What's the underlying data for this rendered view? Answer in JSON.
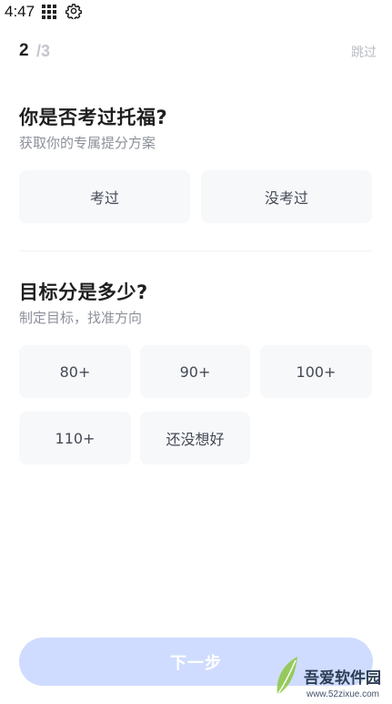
{
  "status_bar": {
    "time": "4:47",
    "icons": [
      "grid-icon",
      "gear-icon"
    ]
  },
  "progress": {
    "current": "2",
    "total": "/3",
    "skip_label": "跳过"
  },
  "question1": {
    "title": "你是否考过托福?",
    "subtitle": "获取你的专属提分方案",
    "options": [
      "考过",
      "没考过"
    ]
  },
  "question2": {
    "title": "目标分是多少?",
    "subtitle": "制定目标，找准方向",
    "options": [
      "80+",
      "90+",
      "100+",
      "110+",
      "还没想好"
    ]
  },
  "footer": {
    "next_label": "下一步"
  },
  "watermark": {
    "brand": "吾爱软件园",
    "url": "www.52zixue.com"
  },
  "colors": {
    "accent_disabled": "#cfdcff",
    "option_bg": "#f7f8fa",
    "muted_text": "#8c9099"
  }
}
